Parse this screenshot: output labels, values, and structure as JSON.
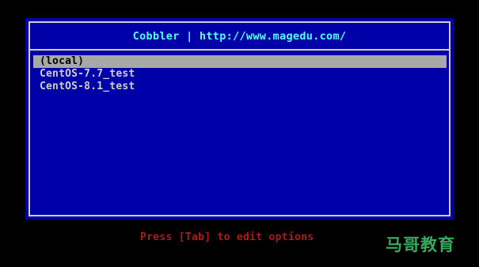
{
  "menu": {
    "title": "Cobbler | http://www.magedu.com/",
    "items": [
      {
        "label": "(local)",
        "selected": true
      },
      {
        "label": "CentOS-7.7_test",
        "selected": false
      },
      {
        "label": "CentOS-8.1_test",
        "selected": false
      }
    ]
  },
  "hint": "Press [Tab] to edit options",
  "watermark": "马哥教育",
  "colors": {
    "screen_background": "#000000",
    "menu_background": "#0000a8",
    "border": "#cfcfcf",
    "title_text": "#55ffff",
    "item_text": "#cfcfcf",
    "selected_background": "#a8a8a8",
    "selected_text": "#000000",
    "hint_text": "#b01818",
    "watermark_text": "#3aa860"
  }
}
